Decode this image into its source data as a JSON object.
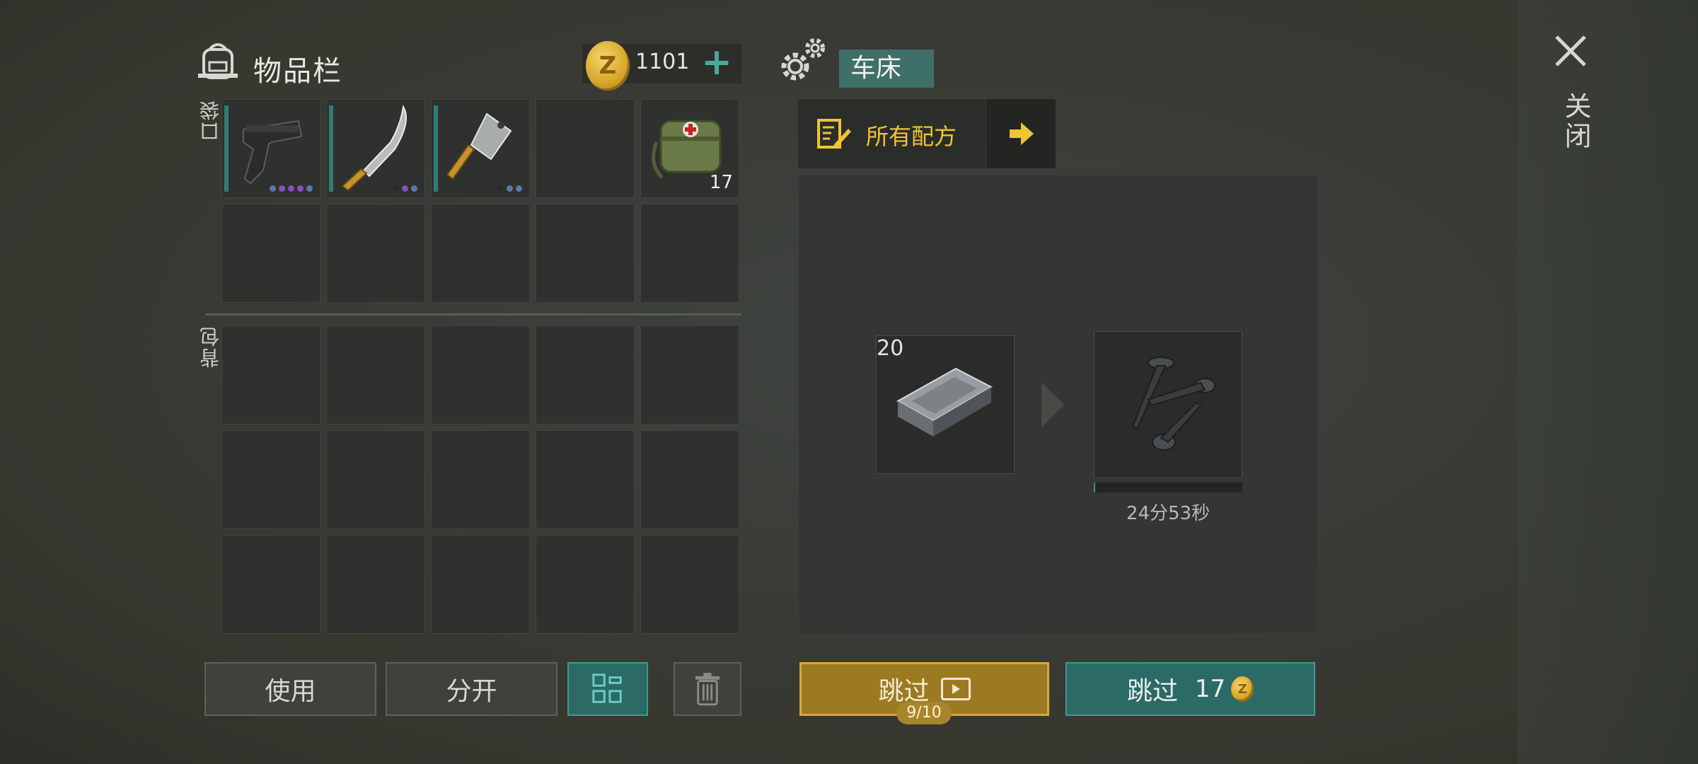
{
  "inventory": {
    "title": "物品栏",
    "coins": "1101",
    "plus": "+",
    "pocket_label": "口袋",
    "backpack_label": "背包",
    "pocket_items": [
      {
        "name": "pistol",
        "count": ""
      },
      {
        "name": "machete",
        "count": ""
      },
      {
        "name": "cleaver",
        "count": ""
      },
      {
        "name": "empty",
        "count": ""
      },
      {
        "name": "medkit-bag",
        "count": "17"
      }
    ]
  },
  "buttons": {
    "use": "使用",
    "split": "分开",
    "skip_ad": "跳过",
    "skip_ad_count": "9/10",
    "skip_coin": "跳过",
    "skip_coin_cost": "17"
  },
  "crafting": {
    "station": "车床",
    "all_recipes": "所有配方",
    "input_count": "20",
    "timer": "24分53秒",
    "progress": 0.01
  },
  "close": "关闭",
  "colors": {
    "accent": "#3d9a90",
    "gold": "#d8a838",
    "recipe": "#f0c434"
  }
}
